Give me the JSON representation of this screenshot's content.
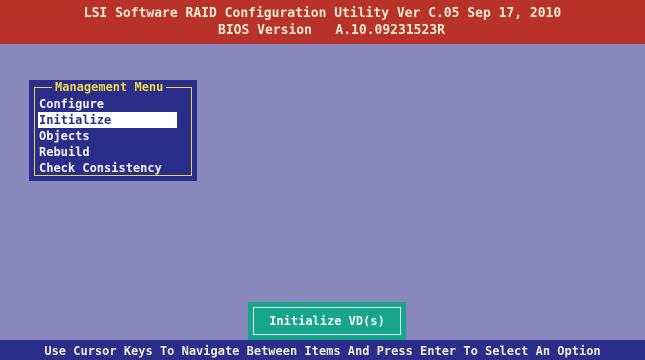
{
  "header": {
    "title_line1": "LSI Software RAID Configuration Utility Ver C.05 Sep 17, 2010",
    "title_line2": "BIOS Version   A.10.09231523R"
  },
  "management_menu": {
    "title": "Management Menu",
    "selected_index": 1,
    "items": [
      {
        "label": "Configure"
      },
      {
        "label": "Initialize"
      },
      {
        "label": "Objects"
      },
      {
        "label": "Rebuild"
      },
      {
        "label": "Check Consistency"
      }
    ]
  },
  "status_box": {
    "label": "Initialize VD(s)"
  },
  "footer": {
    "hint": "Use Cursor Keys To Navigate Between Items And Press Enter To Select An Option"
  },
  "colors": {
    "background": "#8888bc",
    "header_bg": "#b8322a",
    "menu_bg": "#2a2e8a",
    "menu_border": "#e8d44a",
    "status_bg": "#17a58c"
  }
}
